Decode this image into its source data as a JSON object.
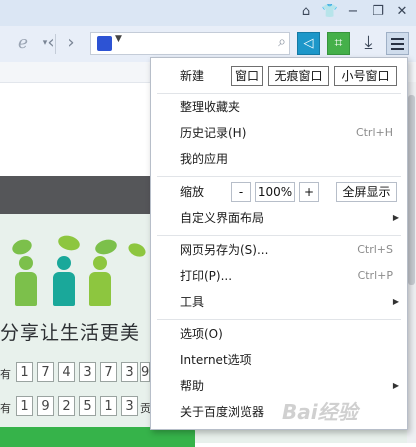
{
  "window": {
    "icons": [
      "home-icon",
      "shirt-icon",
      "minimize-icon",
      "restore-icon",
      "close-icon"
    ]
  },
  "toolbar": {
    "icons": [
      "ie-mode-icon",
      "back-icon",
      "forward-icon",
      "baidu-paw-icon",
      "search-icon",
      "sidebar-toggle-icon",
      "screenshot-crop-icon",
      "download-icon",
      "menu-icon"
    ]
  },
  "page": {
    "slogan": "分享让生活更美",
    "digit_rows": [
      {
        "label": "有",
        "digits": [
          "1",
          "7",
          "4",
          "3",
          "7",
          "3",
          "9"
        ]
      },
      {
        "label": "有",
        "digits": [
          "1",
          "9",
          "2",
          "5",
          "1",
          "3"
        ],
        "suffix": "贡"
      }
    ]
  },
  "menu": {
    "new_label": "新建",
    "new_window": "窗口",
    "new_incognito": "无痕窗口",
    "new_small": "小号窗口",
    "organize_favorites": "整理收藏夹",
    "history": "历史记录(H)",
    "history_shortcut": "Ctrl+H",
    "my_apps": "我的应用",
    "zoom_label": "缩放",
    "zoom_minus": "-",
    "zoom_value": "100%",
    "zoom_plus": "+",
    "fullscreen": "全屏显示",
    "custom_layout": "自定义界面布局",
    "save_as": "网页另存为(S)...",
    "save_as_shortcut": "Ctrl+S",
    "print": "打印(P)...",
    "print_shortcut": "Ctrl+P",
    "tools": "工具",
    "options": "选项(O)",
    "internet_options": "Internet选项",
    "help": "帮助",
    "about": "关于百度浏览器"
  },
  "watermark": "Bai经验",
  "colors": {
    "titlebar": "#dbe6f4",
    "accent_blue": "#1d97c9",
    "accent_green": "#45b04a",
    "page_green": "#36b34a"
  }
}
